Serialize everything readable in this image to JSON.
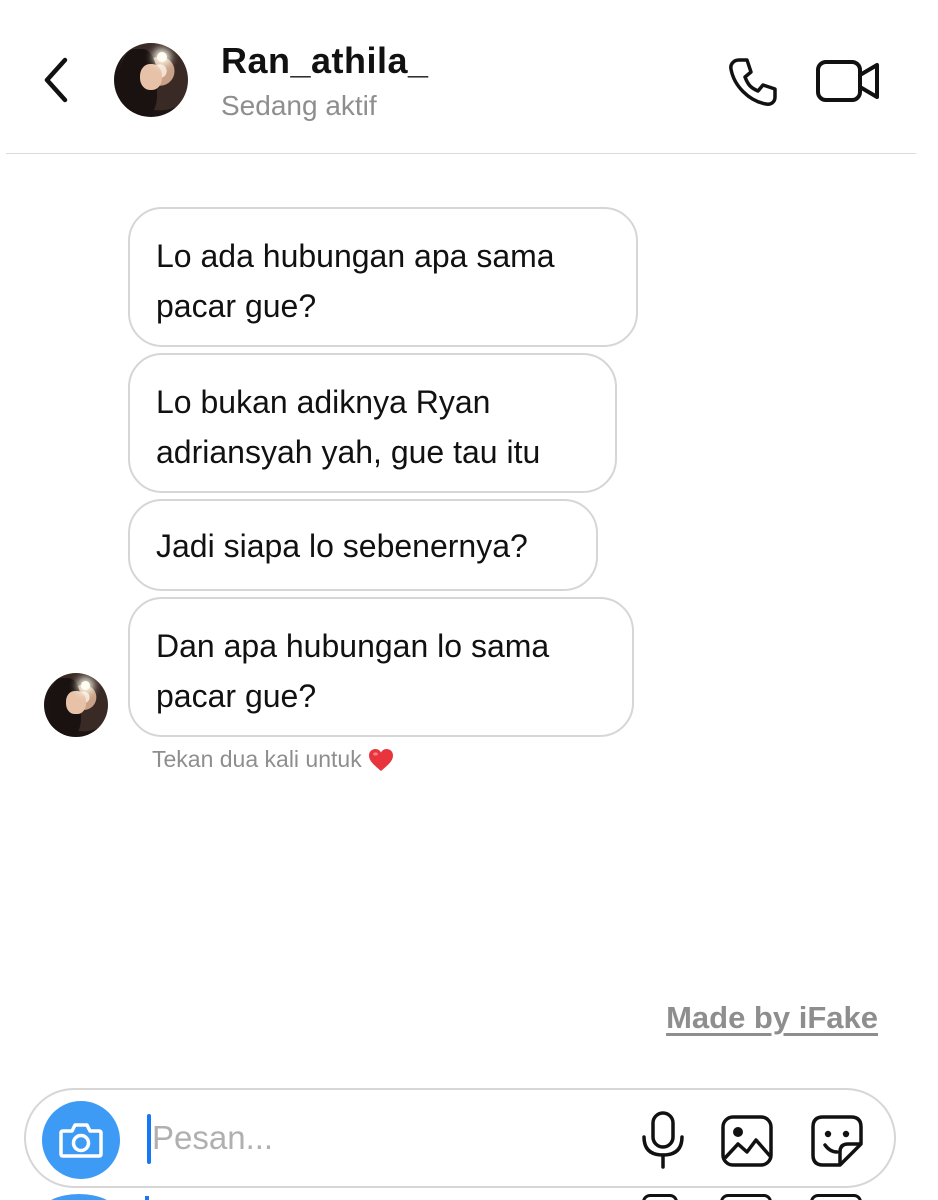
{
  "header": {
    "back_icon": "chevron-left-icon",
    "username": "Ran_athila_",
    "status": "Sedang aktif",
    "call_icon": "phone-icon",
    "video_icon": "video-camera-icon"
  },
  "messages": [
    {
      "text": "Lo ada hubungan apa sama\npacar gue?"
    },
    {
      "text": "Lo bukan adiknya Ryan\nadriansyah yah, gue tau itu"
    },
    {
      "text": "Jadi siapa lo sebenernya?"
    },
    {
      "text": "Dan apa hubungan lo sama\npacar gue?"
    }
  ],
  "hint": {
    "text": "Tekan dua kali untuk",
    "icon": "red-heart-icon"
  },
  "watermark": "Made by iFake",
  "composer": {
    "placeholder": "Pesan...",
    "value": "",
    "camera_icon": "camera-icon",
    "mic_icon": "microphone-icon",
    "gallery_icon": "image-icon",
    "sticker_icon": "sticker-icon"
  },
  "colors": {
    "accent": "#3e9bf5",
    "caret": "#1877f2",
    "secondary_text": "#8e8e8e",
    "bubble_border": "#d6d6d6",
    "heart": "#e8343c"
  }
}
